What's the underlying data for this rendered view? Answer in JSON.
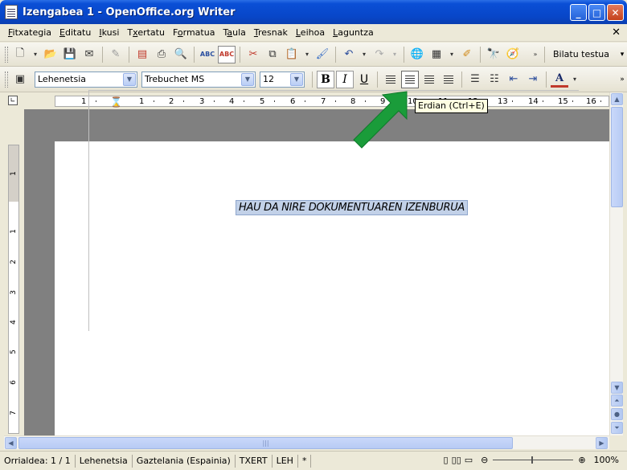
{
  "window": {
    "title": "Izengabea 1 - OpenOffice.org Writer"
  },
  "menu": [
    {
      "pre": "",
      "u": "F",
      "post": "itxategia"
    },
    {
      "pre": "",
      "u": "E",
      "post": "ditatu"
    },
    {
      "pre": "",
      "u": "I",
      "post": "kusi"
    },
    {
      "pre": "T",
      "u": "x",
      "post": "ertatu"
    },
    {
      "pre": "F",
      "u": "o",
      "post": "rmatua"
    },
    {
      "pre": "T",
      "u": "a",
      "post": "ula"
    },
    {
      "pre": "",
      "u": "T",
      "post": "resnak"
    },
    {
      "pre": "",
      "u": "L",
      "post": "eihoa"
    },
    {
      "pre": "",
      "u": "L",
      "post": "aguntza"
    }
  ],
  "toolbar": {
    "find_label": "Bilatu testua"
  },
  "formatting": {
    "style": "Lehenetsia",
    "font": "Trebuchet MS",
    "size": "12",
    "bold": "B",
    "italic": "I",
    "underline": "U",
    "font_color_glyph": "A"
  },
  "ruler": {
    "labels": [
      "1",
      "1",
      "2",
      "3",
      "4",
      "5",
      "6",
      "7",
      "8",
      "9",
      "10",
      "11",
      "12",
      "13",
      "14",
      "15",
      "16"
    ]
  },
  "vruler": {
    "labels": [
      "1",
      "1",
      "2",
      "3",
      "4",
      "5",
      "6",
      "7"
    ]
  },
  "tooltip": {
    "text": "Erdian (Ctrl+E)"
  },
  "document": {
    "heading": "HAU DA NIRE DOKUMENTUAREN IZENBURUA"
  },
  "status": {
    "page": "Orrialdea: 1 / 1",
    "style": "Lehenetsia",
    "language": "Gaztelania (Espainia)",
    "insert_mode": "TXERT",
    "selection_mode": "LEH",
    "modified": "*",
    "zoom": "100%"
  },
  "colors": {
    "titlebar": "#0846c8",
    "annotation_arrow": "#1a9c3a",
    "selection": "#c2d1e8"
  }
}
